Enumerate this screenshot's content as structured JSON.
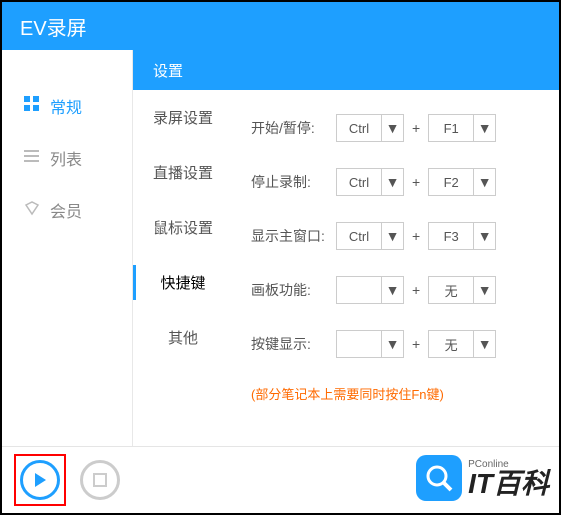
{
  "titlebar": {
    "title": "EV录屏"
  },
  "sidebar": {
    "items": [
      {
        "label": "常规"
      },
      {
        "label": "列表"
      },
      {
        "label": "会员"
      }
    ]
  },
  "settings": {
    "header": "设置",
    "tabs": [
      {
        "label": "录屏设置"
      },
      {
        "label": "直播设置"
      },
      {
        "label": "鼠标设置"
      },
      {
        "label": "快捷键"
      },
      {
        "label": "其他"
      }
    ],
    "rows": [
      {
        "label": "开始/暂停:",
        "mod": "Ctrl",
        "key": "F1"
      },
      {
        "label": "停止录制:",
        "mod": "Ctrl",
        "key": "F2"
      },
      {
        "label": "显示主窗口:",
        "mod": "Ctrl",
        "key": "F3"
      },
      {
        "label": "画板功能:",
        "mod": "",
        "key": "无"
      },
      {
        "label": "按键显示:",
        "mod": "",
        "key": "无"
      }
    ],
    "note": "(部分笔记本上需要同时按住Fn键)",
    "plus": "+"
  },
  "watermark": {
    "small": "PConline",
    "big": "IT百科"
  }
}
